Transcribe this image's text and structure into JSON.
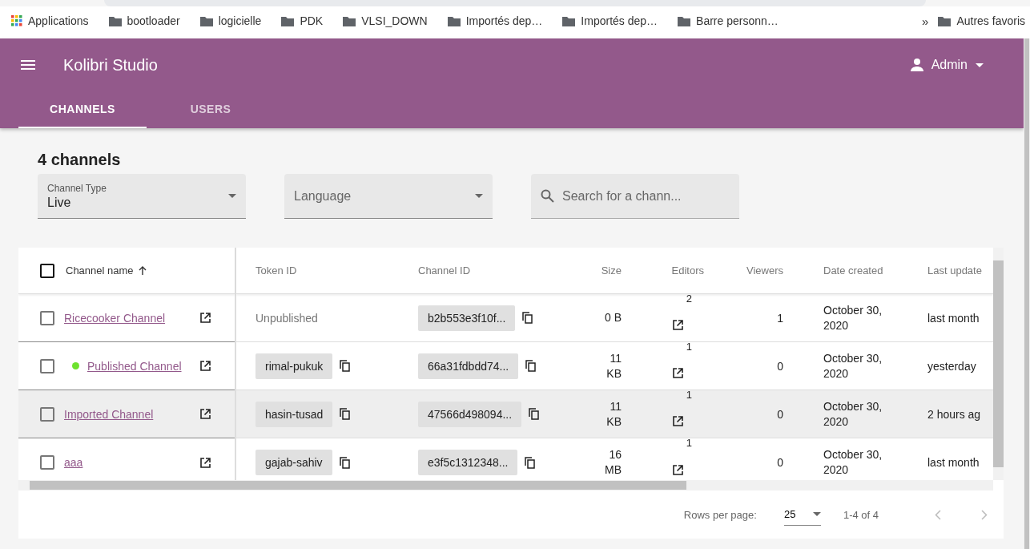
{
  "bookmarks": [
    {
      "label": "Applications",
      "kind": "apps"
    },
    {
      "label": "bootloader",
      "kind": "folder"
    },
    {
      "label": "logicielle",
      "kind": "folder"
    },
    {
      "label": "PDK",
      "kind": "folder"
    },
    {
      "label": "VLSI_DOWN",
      "kind": "folder"
    },
    {
      "label": "Importés dep…",
      "kind": "folder"
    },
    {
      "label": "Importés dep…",
      "kind": "folder"
    },
    {
      "label": "Barre personn…",
      "kind": "folder"
    }
  ],
  "bookmarks_more": "»",
  "other_bookmarks": "Autres favoris",
  "app_bar": {
    "title": "Kolibri Studio",
    "user": "Admin"
  },
  "tabs": [
    {
      "label": "CHANNELS",
      "selected": true
    },
    {
      "label": "USERS",
      "selected": false
    }
  ],
  "heading": "4 channels",
  "filters": {
    "channel_type": {
      "label": "Channel Type",
      "value": "Live"
    },
    "language": {
      "label": "Language"
    },
    "search": {
      "placeholder": "Search for a chann..."
    }
  },
  "table": {
    "columns": [
      "Channel name",
      "Token ID",
      "Channel ID",
      "Size",
      "Editors",
      "Viewers",
      "Date created",
      "Last update"
    ],
    "select_all": {
      "checked": false
    },
    "rows": [
      {
        "name": "Ricecooker Channel",
        "published": false,
        "checked": false,
        "hovered": false,
        "token": {
          "text": "Unpublished",
          "kind": "text"
        },
        "channel_id": "b2b553e3f10f...",
        "size": [
          "0 B"
        ],
        "editors": "2",
        "viewers": "1",
        "date": [
          "October 30,",
          "2020"
        ],
        "updated": "last month"
      },
      {
        "name": "Published Channel",
        "published": true,
        "checked": false,
        "hovered": false,
        "token": {
          "text": "rimal-pukuk",
          "kind": "chip"
        },
        "channel_id": "66a31fdbdd74...",
        "size": [
          "11",
          "KB"
        ],
        "editors": "1",
        "viewers": "0",
        "date": [
          "October 30,",
          "2020"
        ],
        "updated": "yesterday"
      },
      {
        "name": "Imported Channel",
        "published": false,
        "checked": false,
        "hovered": true,
        "token": {
          "text": "hasin-tusad",
          "kind": "chip"
        },
        "channel_id": "47566d498094...",
        "size": [
          "11",
          "KB"
        ],
        "editors": "1",
        "viewers": "0",
        "date": [
          "October 30,",
          "2020"
        ],
        "updated": "2 hours ag"
      },
      {
        "name": "aaa",
        "published": false,
        "checked": false,
        "hovered": false,
        "token": {
          "text": "gajab-sahiv",
          "kind": "chip"
        },
        "channel_id": "e3f5c1312348...",
        "size": [
          "16",
          "MB"
        ],
        "editors": "1",
        "viewers": "0",
        "date": [
          "October 30,",
          "2020"
        ],
        "updated": "last month"
      }
    ]
  },
  "footer": {
    "rows_per_page_label": "Rows per page:",
    "rows_per_page": "25",
    "range": "1-4 of 4"
  }
}
